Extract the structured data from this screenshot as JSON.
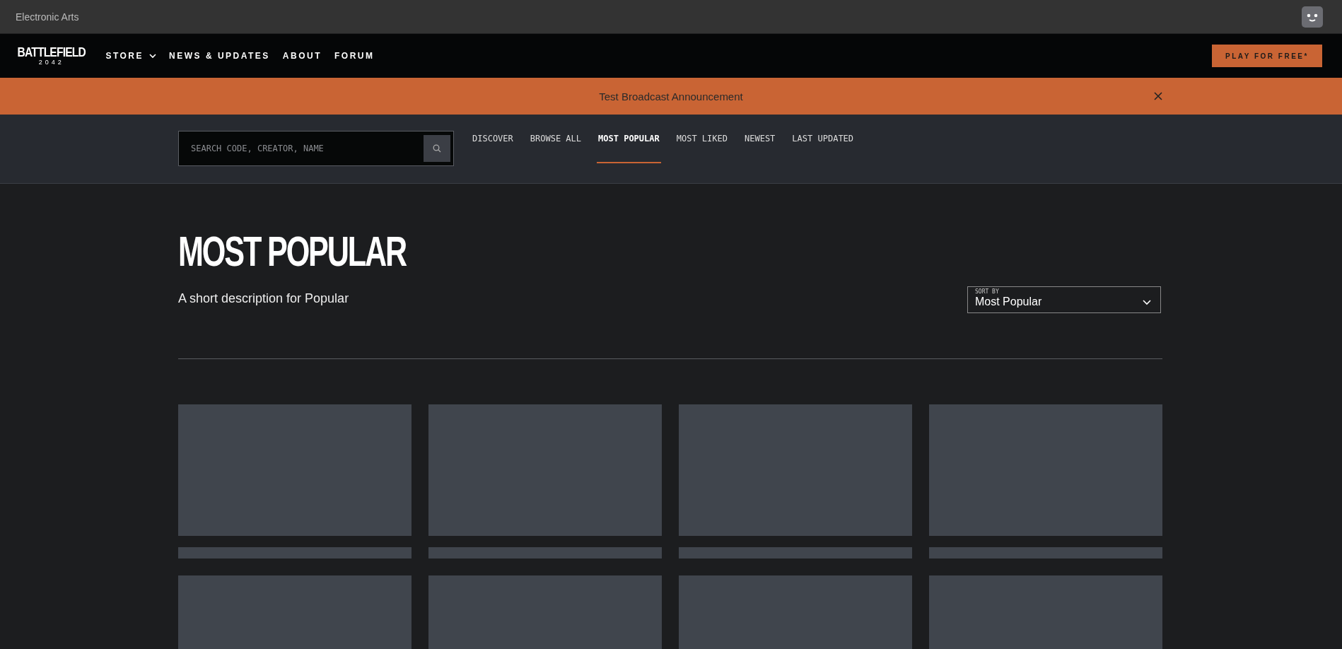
{
  "top_bar": {
    "brand": "Electronic Arts"
  },
  "nav": {
    "logo": {
      "word": "BATTLEFIELD",
      "sub": "2042"
    },
    "items": [
      {
        "label": "STORE",
        "dropdown": true
      },
      {
        "label": "NEWS & UPDATES",
        "dropdown": false
      },
      {
        "label": "ABOUT",
        "dropdown": false
      },
      {
        "label": "FORUM",
        "dropdown": false
      }
    ],
    "cta": "PLAY FOR FREE*"
  },
  "banner": {
    "text": "Test Broadcast Announcement"
  },
  "search": {
    "placeholder": "SEARCH CODE, CREATOR, NAME"
  },
  "tabs": [
    {
      "label": "DISCOVER",
      "selected": false
    },
    {
      "label": "BROWSE ALL",
      "selected": false
    },
    {
      "label": "MOST POPULAR",
      "selected": true
    },
    {
      "label": "MOST LIKED",
      "selected": false
    },
    {
      "label": "NEWEST",
      "selected": false
    },
    {
      "label": "LAST UPDATED",
      "selected": false
    }
  ],
  "page": {
    "title": "MOST POPULAR",
    "description": "A short description for Popular"
  },
  "sort": {
    "label": "SORT BY",
    "value": "Most Popular"
  },
  "cards": [
    {
      "kind": "skeleton"
    },
    {
      "kind": "skeleton"
    },
    {
      "kind": "skeleton"
    },
    {
      "kind": "skeleton"
    }
  ]
}
